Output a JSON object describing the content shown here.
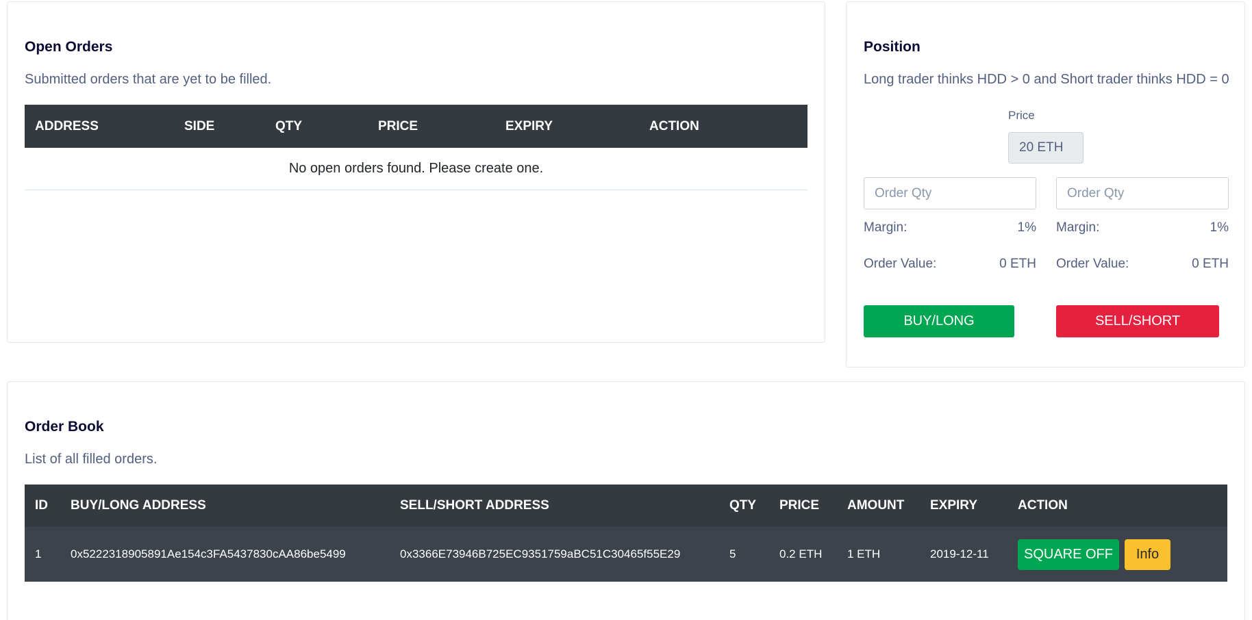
{
  "open_orders": {
    "title": "Open Orders",
    "subtitle": "Submitted orders that are yet to be filled.",
    "columns": [
      "ADDRESS",
      "SIDE",
      "QTY",
      "PRICE",
      "EXPIRY",
      "ACTION"
    ],
    "empty_message": "No open orders found. Please create one."
  },
  "position": {
    "title": "Position",
    "subtitle": "Long trader thinks HDD > 0 and Short trader thinks HDD = 0",
    "price_label": "Price",
    "price_value": "20 ETH",
    "long": {
      "qty_placeholder": "Order Qty",
      "margin_label": "Margin:",
      "margin_value": "1%",
      "order_value_label": "Order Value:",
      "order_value": "0 ETH",
      "button_label": "BUY/LONG"
    },
    "short": {
      "qty_placeholder": "Order Qty",
      "margin_label": "Margin:",
      "margin_value": "1%",
      "order_value_label": "Order Value:",
      "order_value": "0 ETH",
      "button_label": "SELL/SHORT"
    }
  },
  "order_book": {
    "title": "Order Book",
    "subtitle": "List of all filled orders.",
    "columns": [
      "ID",
      "BUY/LONG ADDRESS",
      "SELL/SHORT ADDRESS",
      "QTY",
      "PRICE",
      "AMOUNT",
      "EXPIRY",
      "ACTION"
    ],
    "rows": [
      {
        "id": "1",
        "buy_address": "0x5222318905891Ae154c3FA5437830cAA86be5499",
        "sell_address": "0x3366E73946B725EC9351759aBC51C30465f55E29",
        "qty": "5",
        "price": "0.2 ETH",
        "amount": "1 ETH",
        "expiry": "2019-12-11",
        "square_off_label": "SQUARE OFF",
        "info_label": "Info"
      }
    ]
  },
  "colors": {
    "header_dark": "#343a40",
    "buy_green": "#00a651",
    "sell_red": "#e5213f",
    "info_yellow": "#fbc02d"
  }
}
